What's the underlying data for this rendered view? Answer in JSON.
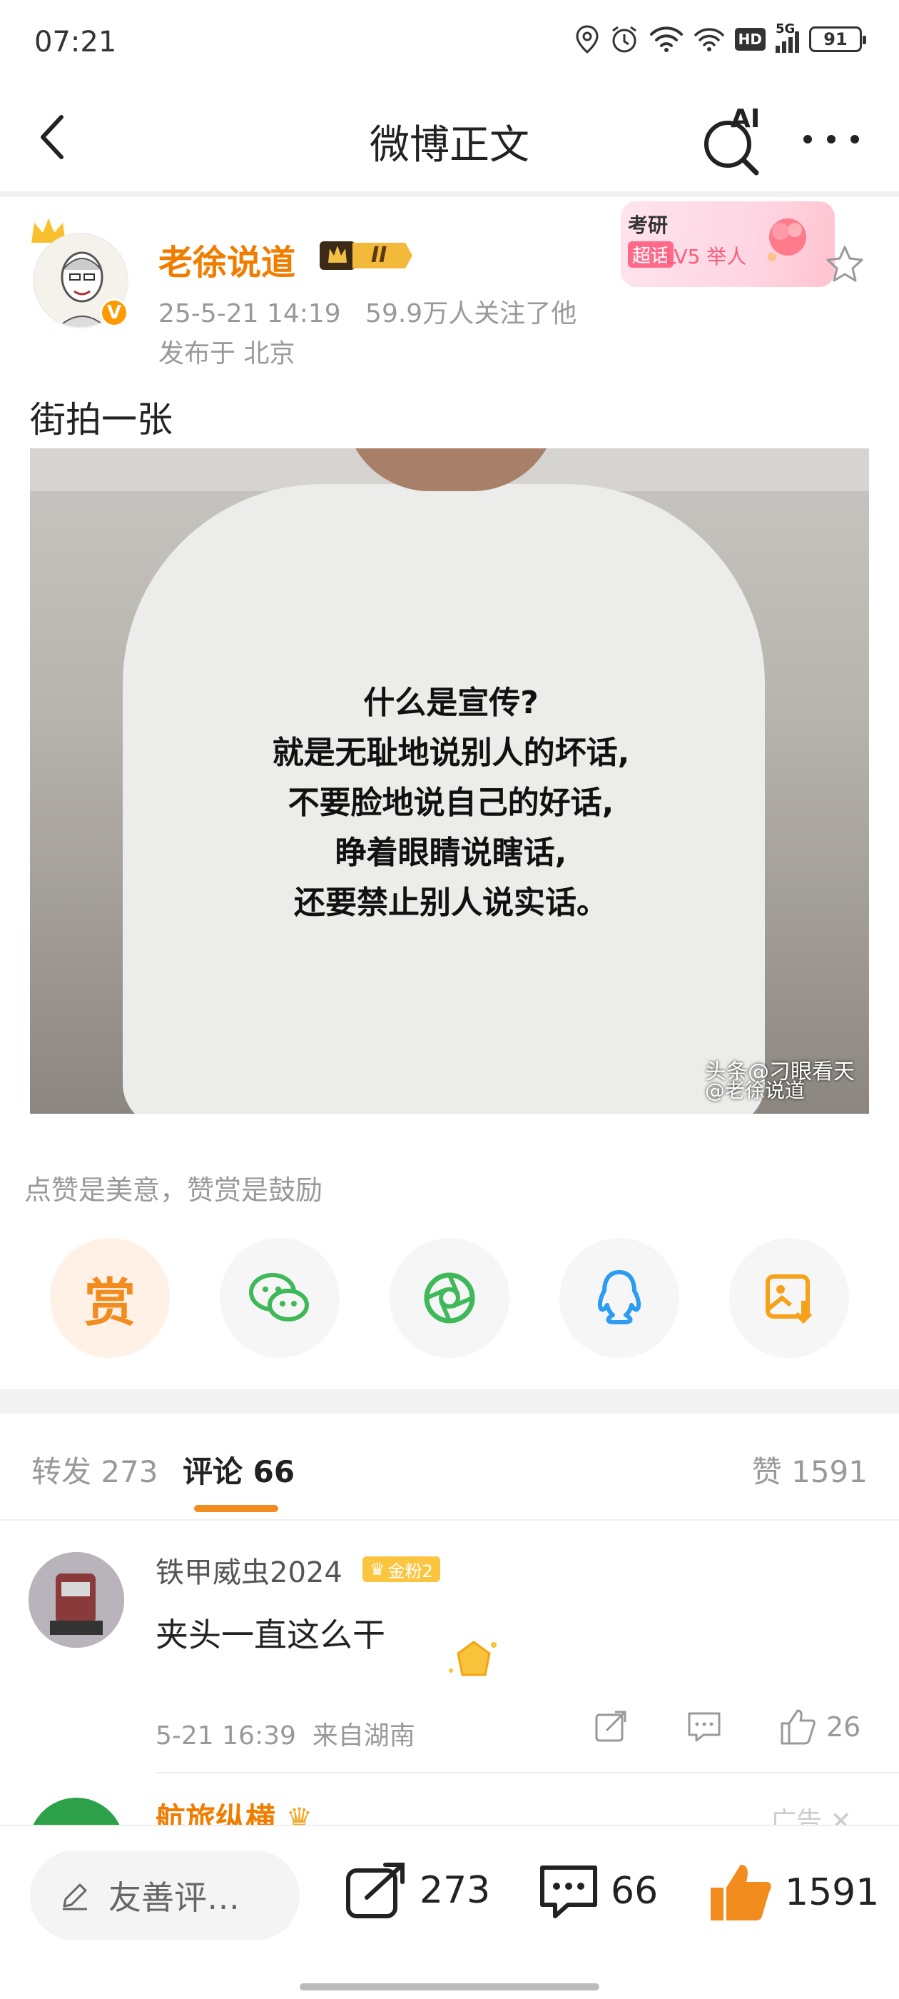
{
  "status_bar": {
    "time": "07:21",
    "network": "5G",
    "hd": "HD",
    "battery": "91"
  },
  "nav": {
    "title": "微博正文",
    "ai_label": "AI"
  },
  "post": {
    "author": "老徐说道",
    "level_badge": "II",
    "time": "25-5-21 14:19",
    "followers": "59.9万人关注了他",
    "location": "发布于 北京",
    "text": "街拍一张",
    "topic_tag": {
      "title": "考研",
      "chip": "超话",
      "level": "LV5 举人"
    },
    "photo": {
      "shirt_lines": [
        "什么是宣传?",
        "就是无耻地说别人的坏话,",
        "不要脸地说自己的好话,",
        "睁着眼睛说瞎话,",
        "还要禁止别人说实话。"
      ],
      "watermark_1": "头条@刁眼看天",
      "watermark_2": "@老徐说道"
    }
  },
  "reward": {
    "hint": "点赞是美意，赞赏是鼓励",
    "reward_label": "赏",
    "share_targets": [
      "reward-icon",
      "wechat-icon",
      "moments-icon",
      "qq-icon",
      "save-image-icon"
    ]
  },
  "tabs": {
    "repost": "转发 273",
    "comments": "评论 66",
    "likes": "赞 1591"
  },
  "comment": {
    "user": "铁甲威虫2024",
    "fan_badge": "金粉2",
    "text": "夹头一直这么干",
    "time": "5-21 16:39",
    "from": "来自湖南",
    "like_count": "26"
  },
  "next_item": {
    "user": "航旅纵横",
    "ad_label": "广告"
  },
  "bottom_bar": {
    "placeholder": "友善评…",
    "reposts": "273",
    "comments": "66",
    "likes": "1591"
  },
  "colors": {
    "accent": "#f28c1e",
    "author": "#f07d00"
  }
}
